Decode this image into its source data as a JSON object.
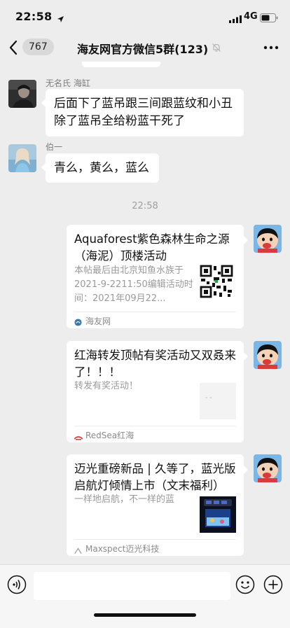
{
  "status": {
    "time": "22:58",
    "network": "4G"
  },
  "header": {
    "unread_count": "767",
    "title": "海友网官方微信5群(123)"
  },
  "messages": [
    {
      "sender": "无名氏 海缸",
      "text": "后面下了蓝吊跟三间跟蓝纹和小丑除了蓝吊全给粉蓝干死了"
    },
    {
      "sender": "伯一",
      "text": "青么，黄么，蓝么"
    }
  ],
  "timestamp": "22:58",
  "cards": [
    {
      "title": "Aquaforest紫色森林生命之源（海泥）顶楼活动",
      "desc": "本帖最后由北京知鱼水族于2021-9-2211:50编辑活动时间：2021年09月22...",
      "source": "海友网",
      "thumb_icon": "qr-code-icon"
    },
    {
      "title": "红海转发顶帖有奖活动又双叒来了！！！",
      "desc": "转发有奖活动！",
      "source": "RedSea红海",
      "thumb_icon": "dark-image-thumbnail"
    },
    {
      "title": "迈光重磅新品 | 久等了，蓝光版启航灯倾情上市（文末福利）",
      "desc": "一样地启航，不一样的蓝",
      "source": "Maxspect迈光科技",
      "thumb_icon": "aquarium-image-thumbnail"
    }
  ],
  "colors": {
    "background": "#ededed",
    "bubble": "#ffffff",
    "accent_red": "#d93a3a"
  }
}
